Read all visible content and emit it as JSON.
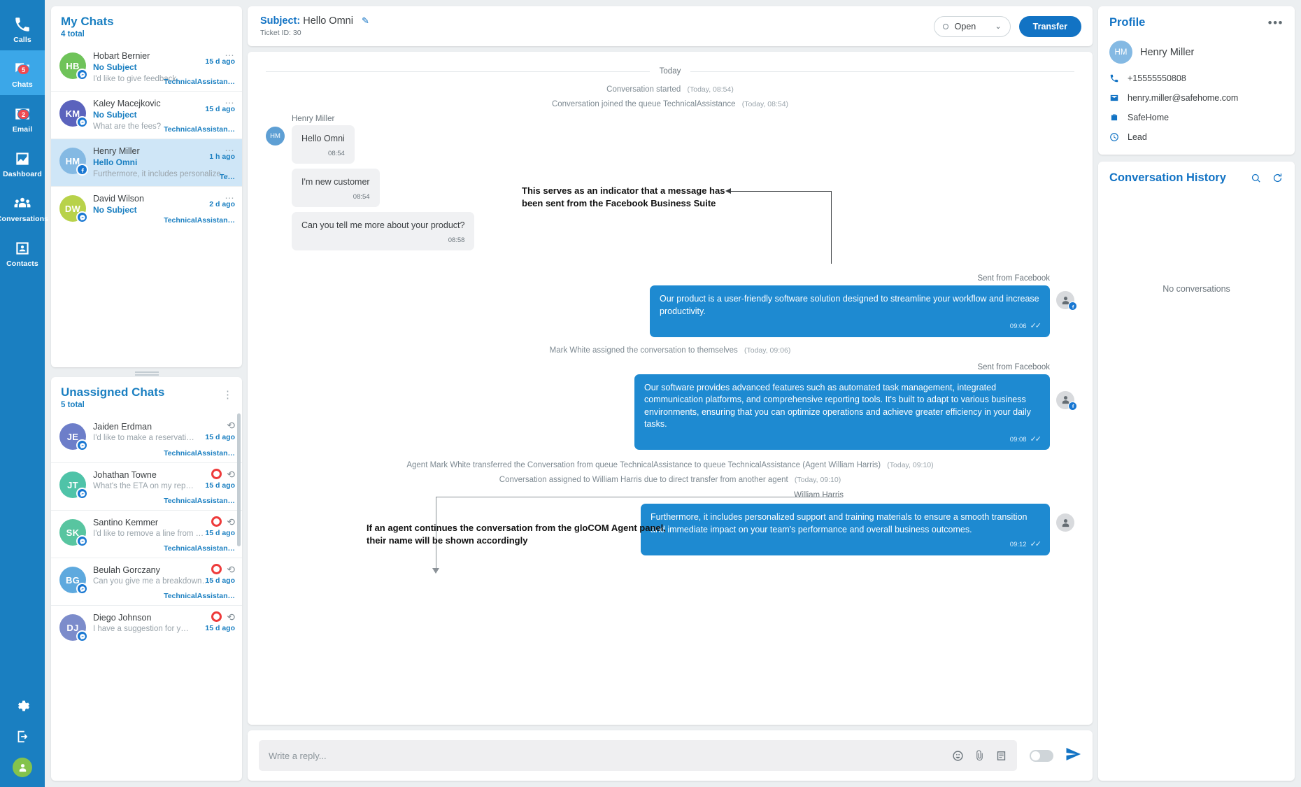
{
  "nav": {
    "items": [
      {
        "label": "Calls",
        "icon": "phone-icon",
        "badge": null,
        "active": false
      },
      {
        "label": "Chats",
        "icon": "chat-icon",
        "badge": "5",
        "active": true
      },
      {
        "label": "Email",
        "icon": "email-icon",
        "badge": "2",
        "active": false
      },
      {
        "label": "Dashboard",
        "icon": "dashboard-icon",
        "badge": null,
        "active": false
      },
      {
        "label": "Conversations",
        "icon": "people-icon",
        "badge": null,
        "active": false
      },
      {
        "label": "Contacts",
        "icon": "contact-card-icon",
        "badge": null,
        "active": false
      }
    ],
    "bottom": [
      {
        "icon": "gear-icon"
      },
      {
        "icon": "logout-icon"
      },
      {
        "icon": "user-avatar-icon"
      }
    ]
  },
  "my_chats": {
    "title": "My Chats",
    "total": "4 total",
    "rows": [
      {
        "name": "Hobart Bernier",
        "initials": "HB",
        "color": "#6fc35a",
        "subject": "No Subject",
        "preview": "I'd like to give feedback.",
        "time": "15 d ago",
        "queue": "TechnicalAssistan…",
        "channel": "messenger-icon",
        "selected": false
      },
      {
        "name": "Kaley Macejkovic",
        "initials": "KM",
        "color": "#5b63bd",
        "subject": "No Subject",
        "preview": "What are the fees?",
        "time": "15 d ago",
        "queue": "TechnicalAssistan…",
        "channel": "messenger-icon",
        "selected": false
      },
      {
        "name": "Henry Miller",
        "initials": "HM",
        "color": "#84b9e3",
        "subject": "Hello Omni",
        "preview": "Furthermore, it includes personalized su…",
        "time": "1 h ago",
        "queue": "Te…",
        "channel": "facebook-icon",
        "selected": true
      },
      {
        "name": "David Wilson",
        "initials": "DW",
        "color": "#b8d24a",
        "subject": "No Subject",
        "preview": "",
        "time": "2 d ago",
        "queue": "TechnicalAssistan…",
        "channel": "messenger-icon",
        "selected": false
      }
    ]
  },
  "unassigned_chats": {
    "title": "Unassigned Chats",
    "total": "5 total",
    "collapse_icon": "collapse-icon",
    "rows": [
      {
        "name": "Jaiden Erdman",
        "initials": "JE",
        "color": "#6d7ec9",
        "preview": "I'd like to make a reservati…",
        "time": "15 d ago",
        "queue": "TechnicalAssistan…",
        "channel": "messenger-icon",
        "recording": false
      },
      {
        "name": "Johathan Towne",
        "initials": "JT",
        "color": "#4fc3a8",
        "preview": "What's the ETA on my rep…",
        "time": "15 d ago",
        "queue": "TechnicalAssistan…",
        "channel": "messenger-icon",
        "recording": true
      },
      {
        "name": "Santino Kemmer",
        "initials": "SK",
        "color": "#58c5a0",
        "preview": "I'd like to remove a line from …",
        "time": "15 d ago",
        "queue": "TechnicalAssistan…",
        "channel": "messenger-icon",
        "recording": true
      },
      {
        "name": "Beulah Gorczany",
        "initials": "BG",
        "color": "#5ea9de",
        "preview": "Can you give me a breakdown…",
        "time": "15 d ago",
        "queue": "TechnicalAssistan…",
        "channel": "messenger-icon",
        "recording": true
      },
      {
        "name": "Diego Johnson",
        "initials": "DJ",
        "color": "#7c8ccb",
        "preview": "I have a suggestion for y…",
        "time": "15 d ago",
        "queue": "",
        "channel": "messenger-icon",
        "recording": true
      }
    ]
  },
  "conversation": {
    "subject_label": "Subject:",
    "subject_value": "Hello Omni",
    "edit_icon": "pencil-icon",
    "ticket": "Ticket ID: 30",
    "status": "Open",
    "status_chevron": "chevron-down-icon",
    "transfer_label": "Transfer",
    "day_separator": "Today",
    "events": [
      {
        "type": "system",
        "text": "Conversation started",
        "ts": "(Today, 08:54)"
      },
      {
        "type": "system",
        "text": "Conversation joined the queue TechnicalAssistance",
        "ts": "(Today, 08:54)"
      }
    ],
    "incoming": {
      "sender": "Henry Miller",
      "initials": "HM",
      "messages": [
        {
          "text": "Hello Omni",
          "time": "08:54"
        },
        {
          "text": "I'm new customer",
          "time": "08:54"
        },
        {
          "text": "Can you tell me more about your product?",
          "time": "08:58"
        }
      ]
    },
    "outgoing_1": {
      "sent_from": "Sent from Facebook",
      "text": "Our product is a user-friendly software solution designed to streamline your workflow and increase productivity.",
      "time": "09:06",
      "ticks": "✓✓"
    },
    "system_assign": {
      "text": "Mark White assigned the conversation to themselves",
      "ts": "(Today, 09:06)"
    },
    "outgoing_2": {
      "sent_from": "Sent from Facebook",
      "text": "Our software provides advanced features such as automated task management, integrated communication platforms, and comprehensive reporting tools. It's built to adapt to various business environments, ensuring that you can optimize operations and achieve greater efficiency in your daily tasks.",
      "time": "09:08",
      "ticks": "✓✓"
    },
    "system_transfer": {
      "text": "Agent Mark White transferred the Conversation from queue TechnicalAssistance to queue TechnicalAssistance (Agent William Harris)",
      "ts": "(Today, 09:10)"
    },
    "system_assigned_to": {
      "text": "Conversation assigned to William Harris due to direct transfer from another agent",
      "ts": "(Today, 09:10)"
    },
    "outgoing_3": {
      "agent_name": "William Harris",
      "text": "Furthermore, it includes personalized support and training materials to ensure a smooth transition and immediate impact on your team's performance and overall business outcomes.",
      "time": "09:12",
      "ticks": "✓✓"
    },
    "annotations": [
      {
        "id": "facebook-indicator",
        "line1": "This serves as an indicator that a message has",
        "line2": "been sent from the Facebook Business Suite"
      },
      {
        "id": "agent-name-note",
        "line1": "If an agent continues the conversation from the gloCOM Agent panel,",
        "line2": "their name will be shown accordingly"
      }
    ],
    "composer": {
      "placeholder": "Write a reply...",
      "icons": [
        "emoji-icon",
        "attachment-icon",
        "canned-response-icon"
      ],
      "toggle": "off",
      "send_icon": "send-icon"
    }
  },
  "profile": {
    "title": "Profile",
    "menu_icon": "more-icon",
    "initials": "HM",
    "name": "Henry Miller",
    "fields": [
      {
        "icon": "phone-icon",
        "value": "+15555550808"
      },
      {
        "icon": "email-icon",
        "value": "henry.miller@safehome.com"
      },
      {
        "icon": "briefcase-icon",
        "value": "SafeHome"
      },
      {
        "icon": "clock-icon",
        "value": "Lead"
      }
    ]
  },
  "history": {
    "title": "Conversation History",
    "search_icon": "search-icon",
    "refresh_icon": "refresh-icon",
    "empty": "No conversations"
  },
  "colors": {
    "accent": "#1273c4",
    "nav": "#1a7fc1",
    "nav_active": "#3ba7e8",
    "bubble_out": "#1e8ad1",
    "badge": "#ef4a50"
  }
}
